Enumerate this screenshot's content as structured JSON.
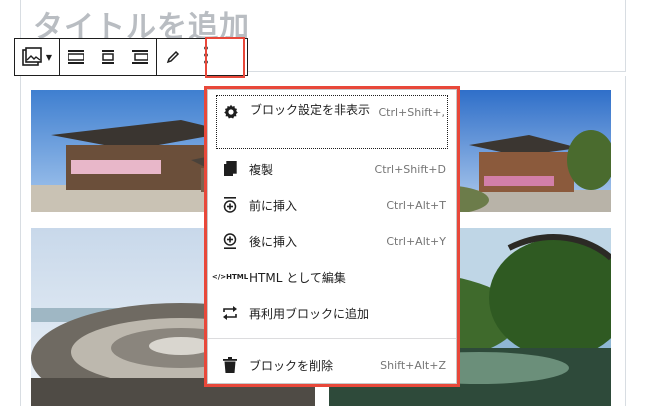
{
  "editor": {
    "title_placeholder": "タイトルを追加"
  },
  "toolbar": {
    "buttons": [
      {
        "name": "gallery-block-type",
        "icon": "gallery-icon",
        "has_dropdown": true
      },
      {
        "name": "align-wide",
        "icon": "align-wide-icon"
      },
      {
        "name": "align-center",
        "icon": "align-center-icon"
      },
      {
        "name": "align-full",
        "icon": "align-full-icon"
      },
      {
        "name": "edit",
        "icon": "pencil-icon"
      },
      {
        "name": "more-options",
        "icon": "more-vertical-icon",
        "highlighted": true
      }
    ]
  },
  "menu": {
    "items": [
      {
        "icon": "gear-icon",
        "label": "ブロック設定を非表示",
        "shortcut": "Ctrl+Shift+,",
        "focused": true
      },
      {
        "icon": "duplicate-icon",
        "label": "複製",
        "shortcut": "Ctrl+Shift+D"
      },
      {
        "icon": "insert-before-icon",
        "label": "前に挿入",
        "shortcut": "Ctrl+Alt+T"
      },
      {
        "icon": "insert-after-icon",
        "label": "後に挿入",
        "shortcut": "Ctrl+Alt+Y"
      },
      {
        "icon": "html-icon",
        "icon_text": "HTML",
        "label": "HTML として編集",
        "shortcut": ""
      },
      {
        "icon": "reusable-icon",
        "label": "再利用ブロックに追加",
        "shortcut": ""
      },
      {
        "icon": "trash-icon",
        "label": "ブロックを削除",
        "shortcut": "Shift+Alt+Z"
      }
    ]
  },
  "colors": {
    "highlight": "#e8483a",
    "placeholder": "#b9bdc2",
    "text": "#1e1e1e",
    "shortcut": "#757575"
  }
}
